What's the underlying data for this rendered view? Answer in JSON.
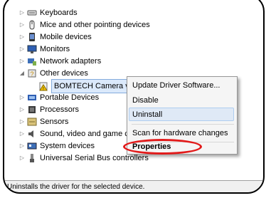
{
  "tree": {
    "items": [
      {
        "label": "Keyboards",
        "icon": "keyboard-icon",
        "expander": "▷"
      },
      {
        "label": "Mice and other pointing devices",
        "icon": "mouse-icon",
        "expander": "▷"
      },
      {
        "label": "Mobile devices",
        "icon": "mobile-device-icon",
        "expander": "▷"
      },
      {
        "label": "Monitors",
        "icon": "monitor-icon",
        "expander": "▷"
      },
      {
        "label": "Network adapters",
        "icon": "network-adapter-icon",
        "expander": "▷"
      },
      {
        "label": "Other devices",
        "icon": "other-devices-icon",
        "expander": "◢"
      },
      {
        "label": "BOMTECH Camera v1.0",
        "icon": "unknown-device-warning-icon",
        "expander": ""
      },
      {
        "label": "Portable Devices",
        "icon": "portable-device-icon",
        "expander": "▷"
      },
      {
        "label": "Processors",
        "icon": "processor-icon",
        "expander": "▷"
      },
      {
        "label": "Sensors",
        "icon": "sensor-icon",
        "expander": "▷"
      },
      {
        "label": "Sound, video and game controllers",
        "icon": "sound-icon",
        "expander": "▷"
      },
      {
        "label": "System devices",
        "icon": "system-devices-icon",
        "expander": "▷"
      },
      {
        "label": "Universal Serial Bus controllers",
        "icon": "usb-icon",
        "expander": "▷"
      }
    ]
  },
  "context_menu": {
    "items": [
      {
        "label": "Update Driver Software..."
      },
      {
        "label": "Disable"
      },
      {
        "label": "Uninstall"
      },
      {
        "label": "Scan for hardware changes"
      },
      {
        "label": "Properties"
      }
    ]
  },
  "status_bar": {
    "text": "Uninstalls the driver for the selected device."
  },
  "colors": {
    "highlight": "#e21a1a",
    "selection": "#dbe9fb",
    "menu_hover": "#dfe9f6"
  }
}
